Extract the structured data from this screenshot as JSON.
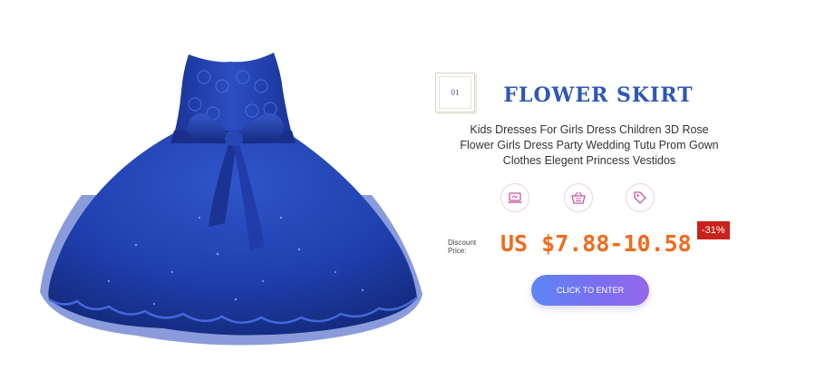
{
  "product": {
    "index_number": "01",
    "title": "FLOWER SKIRT",
    "description": "Kids Dresses For Girls Dress Children 3D Rose Flower Girls Dress Party Wedding Tutu Prom Gown Clothes Elegent Princess Vestidos",
    "price_label": "Discount Price:",
    "price": "US $7.88-10.58",
    "discount_badge": "-31%",
    "cta_label": "CLICK TO ENTER"
  },
  "icons": [
    "laptop-icon",
    "shopping-basket-icon",
    "price-tag-icon"
  ],
  "colors": {
    "title": "#2f57b8",
    "price": "#f26a1c",
    "badge_bg": "#c9211b",
    "dress": "#1f3fae",
    "icon_stroke": "#c9559e",
    "button_start": "#5c86f5",
    "button_end": "#9468ea"
  }
}
